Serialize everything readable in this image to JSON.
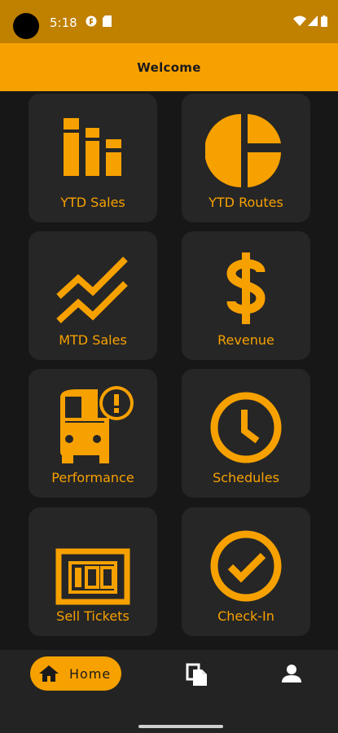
{
  "status_bar": {
    "time": "5:18",
    "icons": [
      "camera-cutout",
      "app-notification-icon",
      "sim-card-icon",
      "wifi-icon",
      "signal-icon",
      "battery-icon"
    ]
  },
  "app_bar": {
    "title": "Welcome"
  },
  "tiles": [
    {
      "label": "YTD Sales",
      "icon": "bar-chart-icon"
    },
    {
      "label": "YTD Routes",
      "icon": "pie-chart-icon"
    },
    {
      "label": "MTD Sales",
      "icon": "trend-lines-icon"
    },
    {
      "label": "Revenue",
      "icon": "dollar-icon"
    },
    {
      "label": "Performance",
      "icon": "bus-alert-icon"
    },
    {
      "label": "Schedules",
      "icon": "clock-icon"
    },
    {
      "label": "Sell Tickets",
      "icon": "ticket-counter-icon"
    },
    {
      "label": "Check-In",
      "icon": "check-circle-icon"
    }
  ],
  "bottom_nav": {
    "home_label": "Home",
    "items": [
      "home-icon",
      "documents-icon",
      "profile-icon"
    ],
    "active": "Home"
  },
  "colors": {
    "accent": "#f7a100",
    "status_bar": "#c08000",
    "background": "#171717",
    "tile": "#262626",
    "nav": "#232323"
  }
}
